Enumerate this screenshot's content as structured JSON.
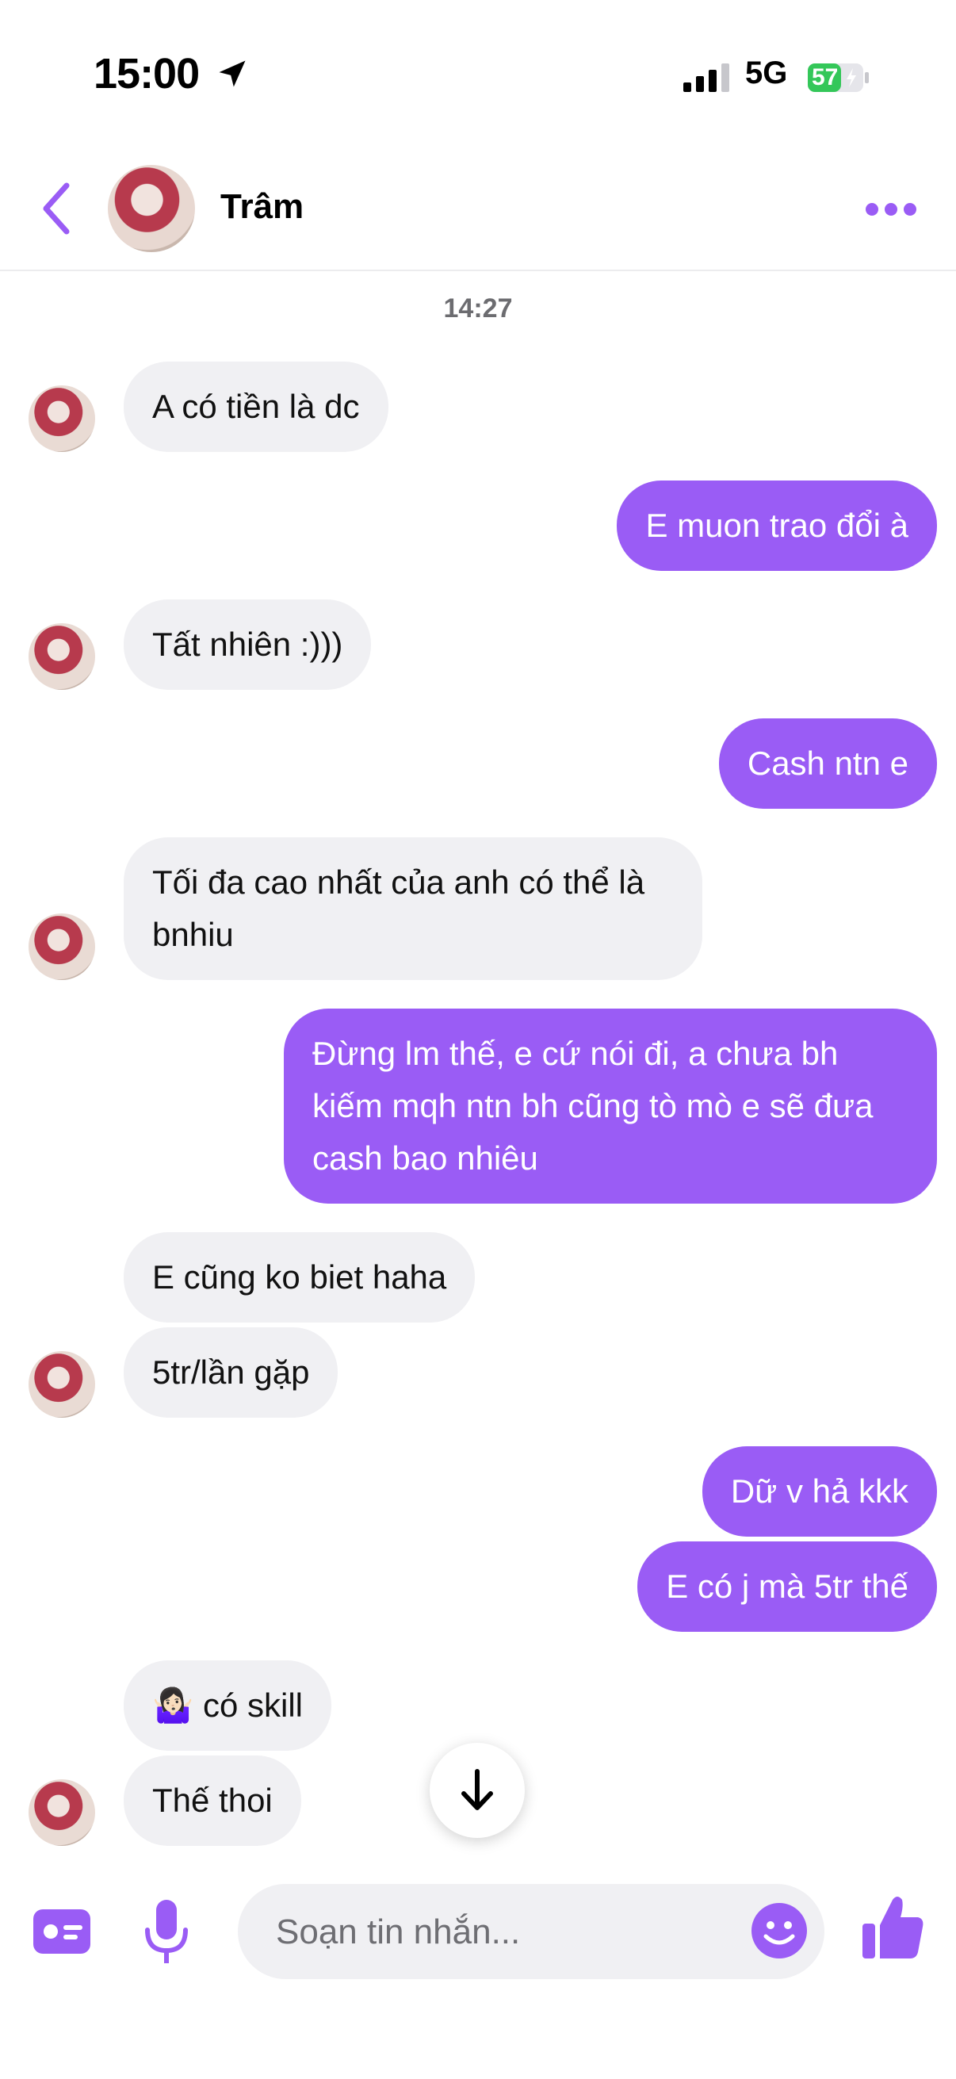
{
  "status_bar": {
    "time": "15:00",
    "network": "5G",
    "battery": "57"
  },
  "header": {
    "contact_name": "Trâm"
  },
  "chat": {
    "timestamp": "14:27",
    "messages": [
      {
        "from": "them",
        "text": "A có tiền là dc"
      },
      {
        "from": "me",
        "text": "E muon trao đổi à"
      },
      {
        "from": "them",
        "text": "Tất nhiên :)))"
      },
      {
        "from": "me",
        "text": "Cash ntn e"
      },
      {
        "from": "them",
        "text": "Tối đa cao nhất của anh có thể là bnhiu"
      },
      {
        "from": "me",
        "text": "Đừng lm thế, e cứ nói đi, a chưa bh kiếm mqh ntn bh cũng tò mò e sẽ đưa cash bao nhiêu"
      },
      {
        "from": "them",
        "text": "E cũng ko biet haha"
      },
      {
        "from": "them",
        "text": "5tr/lần gặp"
      },
      {
        "from": "me",
        "text": "Dữ v hả kkk"
      },
      {
        "from": "me",
        "text": "E có j mà 5tr thế"
      },
      {
        "from": "them",
        "text": "🤷🏻‍♀️ có skill"
      },
      {
        "from": "them",
        "text": "Thế thoi"
      }
    ]
  },
  "composer": {
    "placeholder": "Soạn tin nhắn..."
  },
  "colors": {
    "accent": "#9a5cf5",
    "incoming_bubble": "#f0f0f3",
    "outgoing_text": "#ffffff"
  },
  "icons": {
    "back": "chevron-left-icon",
    "more": "more-dots-icon",
    "location": "location-arrow-icon",
    "card": "contact-card-icon",
    "mic": "microphone-icon",
    "emoji": "smiley-icon",
    "like": "thumbs-up-icon",
    "scroll": "arrow-down-icon"
  }
}
